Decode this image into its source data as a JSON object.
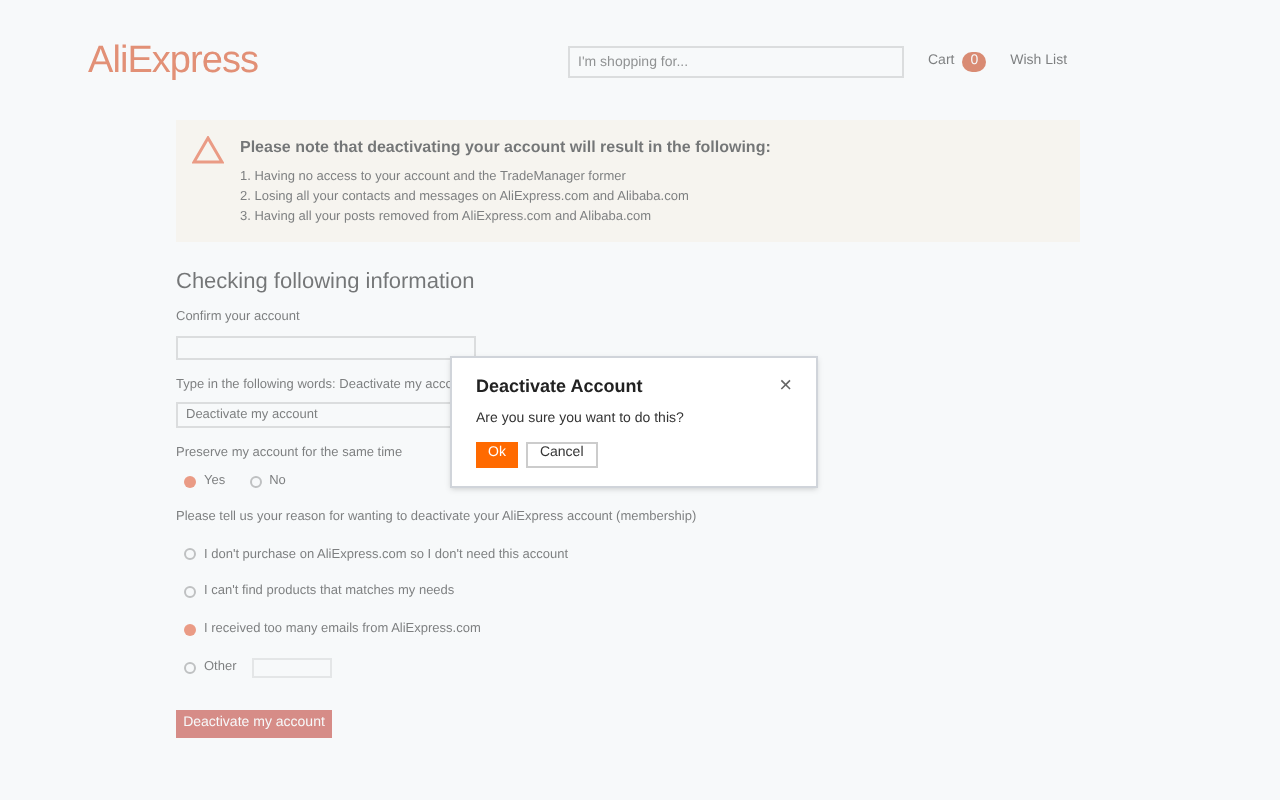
{
  "header": {
    "logo": "AliExpress",
    "search": {
      "placeholder": "I'm shopping for..."
    },
    "cart": {
      "label": "Cart",
      "count": "0"
    },
    "wish_list": "Wish List"
  },
  "notice": {
    "title": "Please note that deactivating your account will result in the following:",
    "items": [
      "1. Having no access to your account and the TradeManager former",
      "2. Losing all your contacts and messages on AliExpress.com and Alibaba.com",
      "3. Having all your posts removed from AliExpress.com and Alibaba.com"
    ]
  },
  "form": {
    "heading": "Checking following information",
    "confirm_label": "Confirm your account",
    "type_label": "Type in the following words: Deactivate my acco",
    "type_value": "Deactivate my account",
    "preserve_label": "Preserve my account for the same time",
    "preserve_options": [
      {
        "label": "Yes",
        "selected": true
      },
      {
        "label": "No",
        "selected": false
      }
    ],
    "reason_label": "Please tell us your reason for wanting to deactivate your AliExpress account (membership)",
    "reasons": [
      {
        "label": "I don't purchase on AliExpress.com so I don't need this account",
        "selected": false
      },
      {
        "label": "I can't find products that matches my needs",
        "selected": false
      },
      {
        "label": "I received too many emails from AliExpress.com",
        "selected": true
      },
      {
        "label": "Other",
        "selected": false
      }
    ],
    "submit": "Deactivate my account"
  },
  "dialog": {
    "title": "Deactivate Account",
    "message": "Are you sure you want to do this?",
    "close": "×",
    "ok": "Ok",
    "cancel": "Cancel"
  }
}
